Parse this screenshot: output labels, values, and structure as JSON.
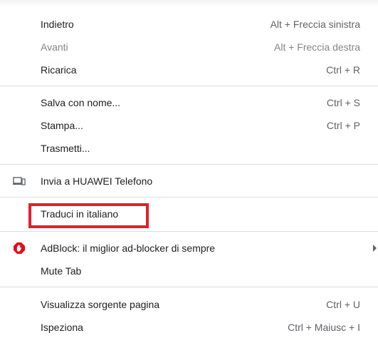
{
  "menu": {
    "items": [
      {
        "label": "Indietro",
        "shortcut": "Alt + Freccia sinistra"
      },
      {
        "label": "Avanti",
        "shortcut": "Alt + Freccia destra",
        "disabled": true
      },
      {
        "label": "Ricarica",
        "shortcut": "Ctrl + R"
      },
      {
        "label": "Salva con nome...",
        "shortcut": "Ctrl + S"
      },
      {
        "label": "Stampa...",
        "shortcut": "Ctrl + P"
      },
      {
        "label": "Trasmetti..."
      },
      {
        "label": "Invia a HUAWEI Telefono",
        "icon": "send-to-device-icon"
      },
      {
        "label": "Traduci in italiano",
        "highlighted": true
      },
      {
        "label": "AdBlock: il miglior ad-blocker di sempre",
        "icon": "adblock-icon",
        "submenu": true
      },
      {
        "label": "Mute Tab"
      },
      {
        "label": "Visualizza sorgente pagina",
        "shortcut": "Ctrl + U"
      },
      {
        "label": "Ispeziona",
        "shortcut": "Ctrl + Maiusc + I"
      }
    ]
  },
  "colors": {
    "highlight_border": "#e3202a",
    "adblock_red": "#e40d18",
    "separator": "#dadce0"
  }
}
